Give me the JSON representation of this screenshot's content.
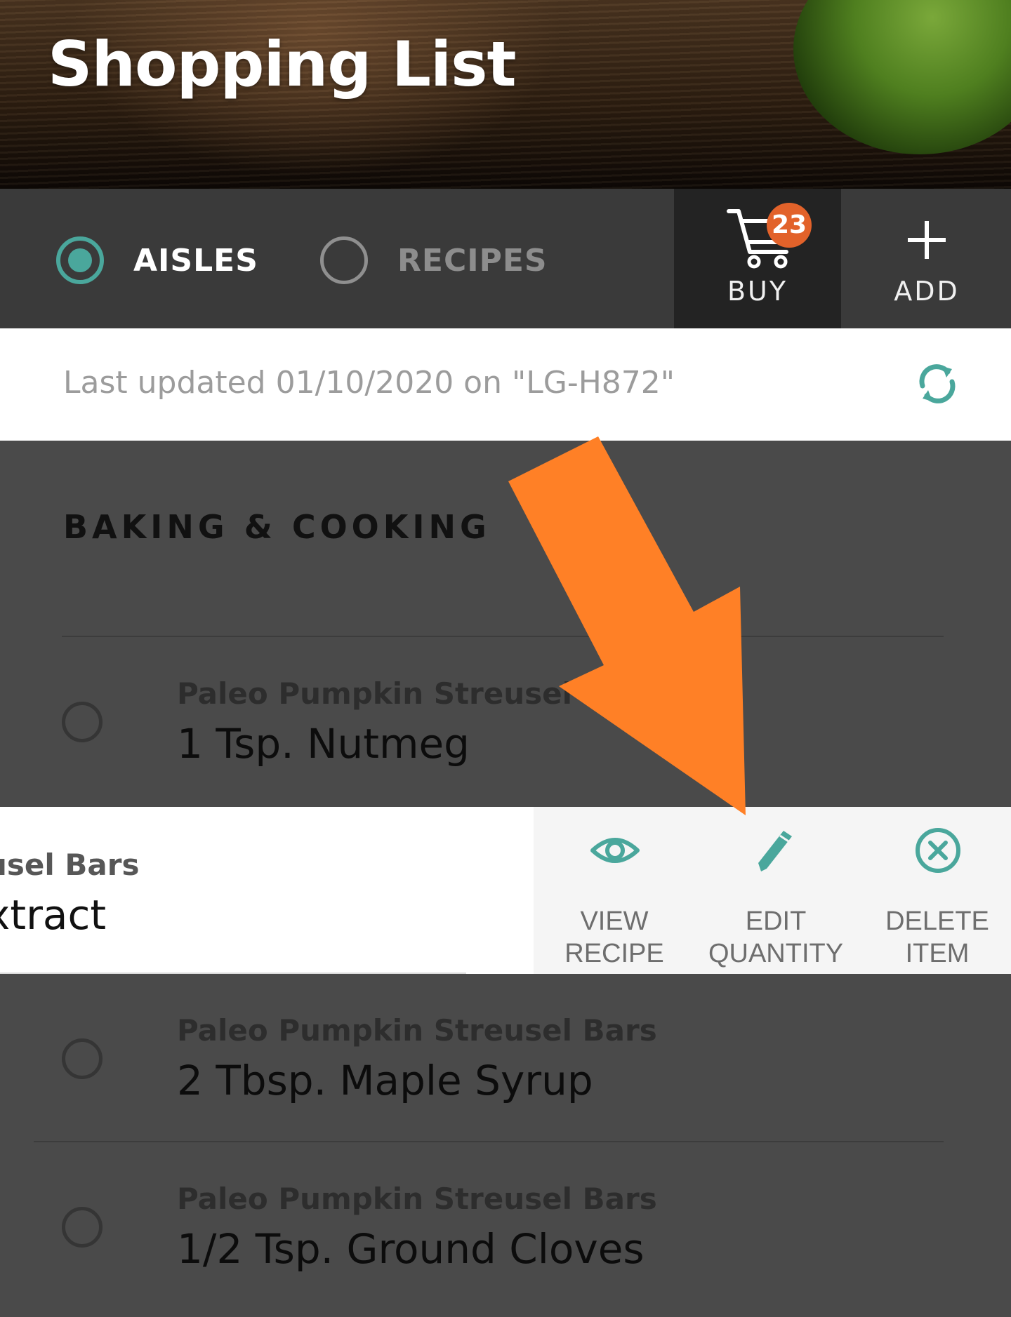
{
  "header": {
    "title": "Shopping List"
  },
  "toolbar": {
    "aisles_label": "AISLES",
    "recipes_label": "RECIPES",
    "selected": "aisles",
    "buy_label": "BUY",
    "cart_count": "23",
    "add_label": "ADD"
  },
  "sync": {
    "text": "Last updated 01/10/2020 on \"LG-H872\""
  },
  "section": {
    "title": "BAKING & COOKING"
  },
  "items": [
    {
      "recipe": "Paleo Pumpkin Streusel Bars",
      "name": "1 Tsp. Nutmeg"
    },
    {
      "recipe": "Paleo Pumpkin Streusel Bars",
      "name": "2 Tbsp. Maple Syrup"
    },
    {
      "recipe": "Paleo Pumpkin Streusel Bars",
      "name": "1/2 Tsp. Ground Cloves"
    }
  ],
  "swiped_item": {
    "recipe_partial": "usel Bars",
    "name_partial": "xtract"
  },
  "actions": {
    "view": "VIEW\nRECIPE",
    "edit": "EDIT\nQUANTITY",
    "delete": "DELETE\nITEM"
  },
  "colors": {
    "accent": "#4aa79c",
    "badge": "#e2622a",
    "arrow": "#ff8026"
  }
}
